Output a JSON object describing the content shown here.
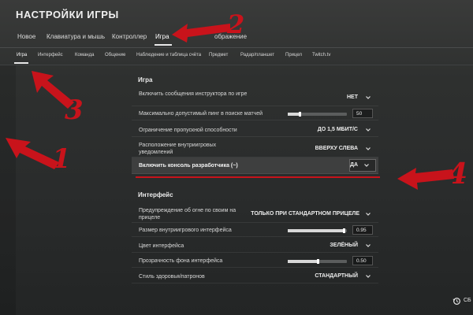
{
  "title": "НАСТРОЙКИ ИГРЫ",
  "main_tabs": [
    "Новое",
    "Клавиатура и мышь",
    "Контроллер",
    "Игра",
    "Изображение"
  ],
  "main_tabs_visible": [
    "Новое",
    "Клавиатура и мышь",
    "Контроллер",
    "Игра",
    "ображение"
  ],
  "active_main_tab": "Игра",
  "sub_tabs": [
    "Игра",
    "Интерфейс",
    "Команда",
    "Общение",
    "Наблюдение и таблица счёта",
    "Предмет",
    "Радар/планшет",
    "Прицел",
    "Twitch.tv"
  ],
  "active_sub_tab": "Игра",
  "section_game": {
    "title": "Игра",
    "rows": [
      {
        "label": "Включить сообщения инструктора по игре",
        "value": "НЕТ"
      },
      {
        "label": "Максимально допустимый пинг в поиске матчей",
        "value": "50",
        "slider_fraction": 0.2
      },
      {
        "label": "Ограничение пропускной способности",
        "value": "ДО 1,5 МБИТ/С"
      },
      {
        "label": "Расположение внутриигровых уведомлений",
        "value": "ВВЕРХУ СЛЕВА"
      },
      {
        "label": "Включить консоль разработчика (~)",
        "value": "ДА"
      }
    ]
  },
  "section_interface": {
    "title": "Интерфейс",
    "rows": [
      {
        "label": "Предупреждение об огне по своим на прицеле",
        "value": "ТОЛЬКО ПРИ СТАНДАРТНОМ ПРИЦЕЛЕ"
      },
      {
        "label": "Размер внутриигрового интерфейса",
        "value": "0.95",
        "slider_fraction": 0.95
      },
      {
        "label": "Цвет интерфейса",
        "value": "ЗЕЛЁНЫЙ"
      },
      {
        "label": "Прозрачность фона интерфейса",
        "value": "0.50",
        "slider_fraction": 0.5
      },
      {
        "label": "Стиль здоровья/патронов",
        "value": "СТАНДАРТНЫЙ"
      }
    ]
  },
  "annotations": [
    "1",
    "2",
    "3",
    "4"
  ],
  "reset_label": "СБ",
  "colors": {
    "annotation": "#c8131b",
    "text": "#e6e6e6",
    "accent_underline": "#e8e8e8"
  },
  "icons": {
    "chevron": "chevron-down-icon",
    "reset": "reset-icon"
  }
}
